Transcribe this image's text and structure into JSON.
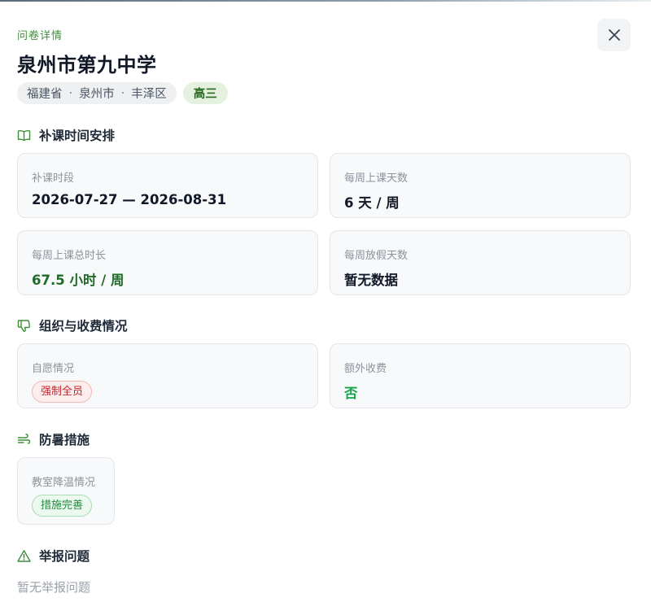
{
  "header": {
    "eyebrow": "问卷详情",
    "title": "泉州市第九中学",
    "region": [
      "福建省",
      "泉州市",
      "丰泽区"
    ],
    "region_separator": "·",
    "grade": "高三"
  },
  "sections": {
    "schedule": {
      "title": "补课时间安排",
      "cards": [
        {
          "label": "补课时段",
          "value": "2026-07-27 — 2026-08-31"
        },
        {
          "label": "每周上课天数",
          "value": "6 天 / 周"
        },
        {
          "label": "每周上课总时长",
          "value": "67.5 小时 / 周"
        },
        {
          "label": "每周放假天数",
          "value": "暂无数据"
        }
      ]
    },
    "organization": {
      "title": "组织与收费情况",
      "cards": [
        {
          "label": "自愿情况",
          "value": "强制全员"
        },
        {
          "label": "额外收费",
          "value": "否"
        }
      ]
    },
    "heat": {
      "title": "防暑措施",
      "cards": [
        {
          "label": "教室降温情况",
          "value": "措施完善"
        }
      ]
    },
    "reports": {
      "title": "举报问题",
      "empty": "暂无举报问题"
    }
  },
  "colors": {
    "accent_green": "#3f8f3a",
    "grade_bg": "#e4f1de",
    "danger": "#c0262d",
    "success": "#16a34a"
  },
  "icons": {
    "close": "close-icon",
    "schedule": "book-open-icon",
    "organization": "thumbs-down-icon",
    "heat": "wind-icon",
    "reports": "warning-triangle-icon"
  }
}
